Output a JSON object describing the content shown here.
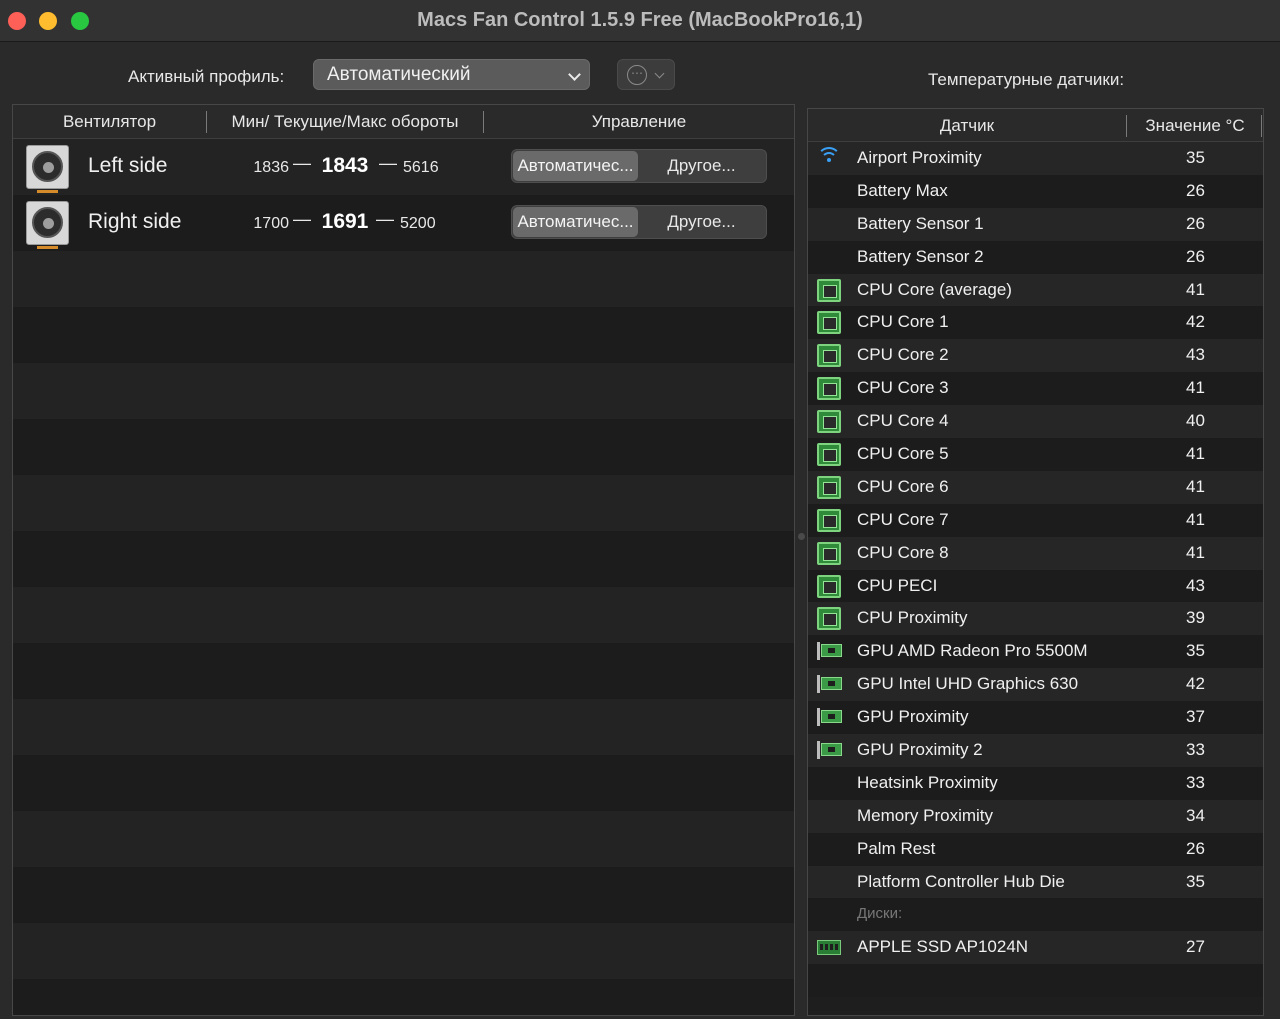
{
  "window": {
    "title": "Macs Fan Control 1.5.9 Free (MacBookPro16,1)"
  },
  "profile": {
    "label": "Активный профиль:",
    "value": "Автоматический",
    "more_glyph": "⋯"
  },
  "sensors_title": "Температурные датчики:",
  "fans_table": {
    "columns": [
      "Вентилятор",
      "Мин/ Текущие/Макс обороты",
      "Управление"
    ],
    "dash": "—",
    "rows": [
      {
        "name": "Left side",
        "min": "1836",
        "current": "1843",
        "max": "5616",
        "auto_label": "Автоматичес...",
        "other_label": "Другое..."
      },
      {
        "name": "Right side",
        "min": "1700",
        "current": "1691",
        "max": "5200",
        "auto_label": "Автоматичес...",
        "other_label": "Другое..."
      }
    ]
  },
  "sensors_table": {
    "columns": [
      "Датчик",
      "Значение °C"
    ],
    "rows": [
      {
        "icon": "wifi-icon",
        "name": "Airport Proximity",
        "value": "35"
      },
      {
        "icon": "",
        "name": "Battery Max",
        "value": "26"
      },
      {
        "icon": "",
        "name": "Battery Sensor 1",
        "value": "26"
      },
      {
        "icon": "",
        "name": "Battery Sensor 2",
        "value": "26"
      },
      {
        "icon": "cpu-icon",
        "name": "CPU Core (average)",
        "value": "41"
      },
      {
        "icon": "cpu-icon",
        "name": "CPU Core 1",
        "value": "42"
      },
      {
        "icon": "cpu-icon",
        "name": "CPU Core 2",
        "value": "43"
      },
      {
        "icon": "cpu-icon",
        "name": "CPU Core 3",
        "value": "41"
      },
      {
        "icon": "cpu-icon",
        "name": "CPU Core 4",
        "value": "40"
      },
      {
        "icon": "cpu-icon",
        "name": "CPU Core 5",
        "value": "41"
      },
      {
        "icon": "cpu-icon",
        "name": "CPU Core 6",
        "value": "41"
      },
      {
        "icon": "cpu-icon",
        "name": "CPU Core 7",
        "value": "41"
      },
      {
        "icon": "cpu-icon",
        "name": "CPU Core 8",
        "value": "41"
      },
      {
        "icon": "cpu-icon",
        "name": "CPU PECI",
        "value": "43"
      },
      {
        "icon": "cpu-icon",
        "name": "CPU Proximity",
        "value": "39"
      },
      {
        "icon": "gpu-icon",
        "name": "GPU AMD Radeon Pro 5500M",
        "value": "35"
      },
      {
        "icon": "gpu-icon",
        "name": "GPU Intel UHD Graphics 630",
        "value": "42"
      },
      {
        "icon": "gpu-icon",
        "name": "GPU Proximity",
        "value": "37"
      },
      {
        "icon": "gpu-icon",
        "name": "GPU Proximity 2",
        "value": "33"
      },
      {
        "icon": "",
        "name": "Heatsink Proximity",
        "value": "33"
      },
      {
        "icon": "",
        "name": "Memory Proximity",
        "value": "34"
      },
      {
        "icon": "",
        "name": "Palm Rest",
        "value": "26"
      },
      {
        "icon": "",
        "name": "Platform Controller Hub Die",
        "value": "35"
      },
      {
        "group": "Диски:"
      },
      {
        "icon": "ssd-icon",
        "name": "APPLE SSD AP1024N",
        "value": "27"
      },
      {
        "blank": true
      }
    ]
  }
}
